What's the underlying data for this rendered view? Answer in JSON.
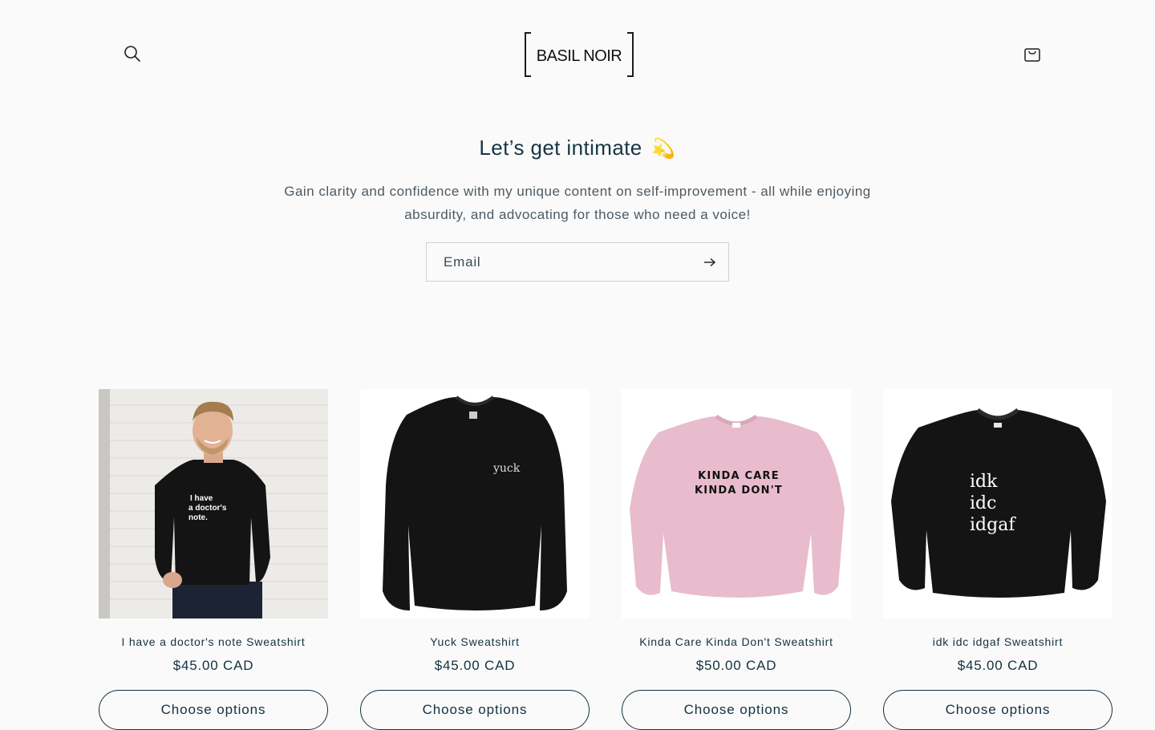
{
  "header": {
    "logo_text": "BASIL NOIR",
    "search_icon": "search-icon",
    "cart_icon": "cart-icon"
  },
  "newsletter": {
    "title": "Let’s get intimate",
    "title_emoji": "💫",
    "subtitle_line1": "Gain clarity and confidence with my unique content on self-improvement - all while enjoying",
    "subtitle_line2": "absurdity, and advocating for those who need a voice!",
    "email_placeholder": "Email",
    "submit_icon": "arrow-right-icon"
  },
  "products": [
    {
      "title": "I have a doctor's note Sweatshirt",
      "price": "$45.00 CAD",
      "button": "Choose options",
      "print": "I have a doctor's note."
    },
    {
      "title": "Yuck Sweatshirt",
      "price": "$45.00 CAD",
      "button": "Choose options",
      "print": "yuck"
    },
    {
      "title": "Kinda Care Kinda Don't Sweatshirt",
      "price": "$50.00 CAD",
      "button": "Choose options",
      "print_line1": "KINDA CARE",
      "print_line2": "KINDA DON'T"
    },
    {
      "title": "idk idc idgaf Sweatshirt",
      "price": "$45.00 CAD",
      "button": "Choose options",
      "print_line1": "idk",
      "print_line2": "idc",
      "print_line3": "idgaf"
    }
  ],
  "colors": {
    "background": "#fafafa",
    "text_dark": "#14313f",
    "sweatshirt_black": "#141414",
    "sweatshirt_pink": "#e8bccd"
  }
}
